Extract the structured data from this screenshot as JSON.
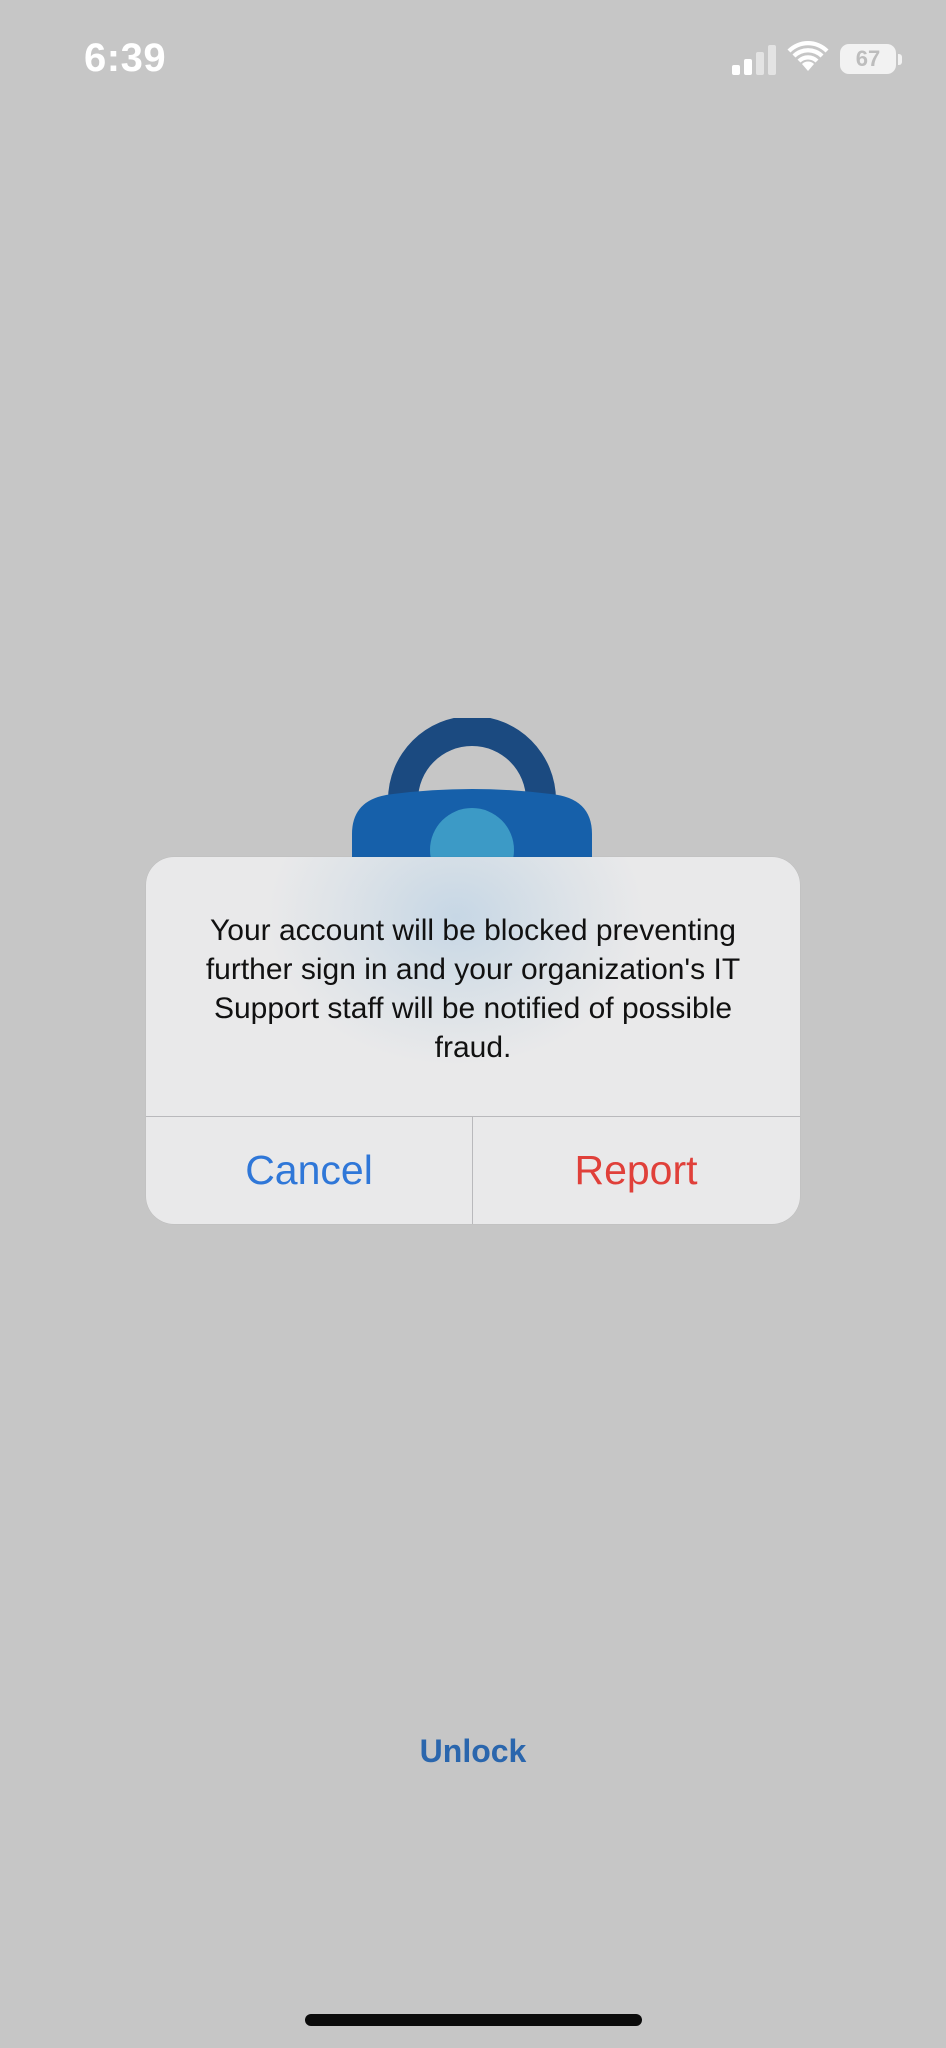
{
  "status_bar": {
    "time": "6:39",
    "battery_level": "67",
    "signal_icon": "cellular-signal-icon",
    "wifi_icon": "wifi-icon",
    "battery_icon": "battery-icon"
  },
  "background": {
    "lock_icon": "padlock-icon",
    "colors": {
      "background": "#c6c6c6",
      "lock_shackle": "#1b4a80",
      "lock_body": "#1660aa",
      "lock_keyhole": "#3c9ac6"
    }
  },
  "alert": {
    "message": "Your account will be blocked preventing further sign in and your organization's IT Support staff will be notified of possible fraud.",
    "cancel_label": "Cancel",
    "report_label": "Report",
    "colors": {
      "cancel": "#2f77d8",
      "report": "#e0403a"
    }
  },
  "footer": {
    "unlock_label": "Unlock",
    "unlock_color": "#2a66ad"
  }
}
